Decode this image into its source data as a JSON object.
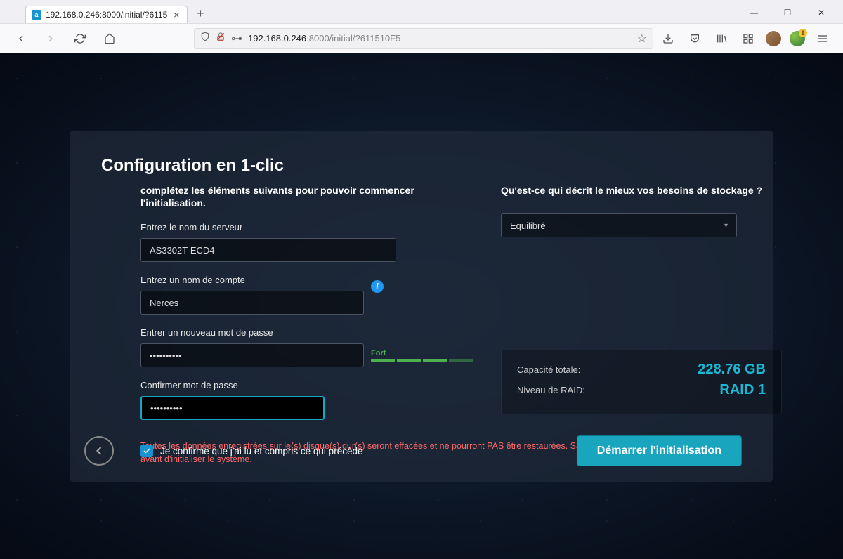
{
  "browser": {
    "tab_title": "192.168.0.246:8000/initial/?6115",
    "url_prefix": "192.168.0.246",
    "url_suffix": ":8000/initial/?611510F5"
  },
  "heading": "Configuration en 1-clic",
  "left": {
    "subtitle": "complétez les éléments suivants pour pouvoir commencer l'initialisation.",
    "server_label": "Entrez le nom du serveur",
    "server_value": "AS3302T-ECD4",
    "account_label": "Entrez un nom de compte",
    "account_value": "Nerces",
    "pw_label": "Entrer un nouveau mot de passe",
    "pw_value": "●●●●●●●●●●",
    "strength_label": "Fort",
    "confirm_label": "Confirmer mot de passe",
    "confirm_value": "●●●●●●●●●●"
  },
  "right": {
    "subtitle": "Qu'est-ce qui décrit le mieux vos besoins de stockage ?",
    "select_value": "Equilibré",
    "capacity_label": "Capacité totale:",
    "capacity_value": "228.76 GB",
    "raid_label": "Niveau de RAID:",
    "raid_value": "RAID 1"
  },
  "warning": "Toutes les données enregistrées sur le(s) disque(s) dur(s) seront effacées et ne pourront PAS être restaurées. Sauvegardez les données importantes avant d'initialiser le système.",
  "confirm_text": "Je confirme que j'ai lu et compris ce qui précède",
  "start_button": "Démarrer l'initialisation"
}
